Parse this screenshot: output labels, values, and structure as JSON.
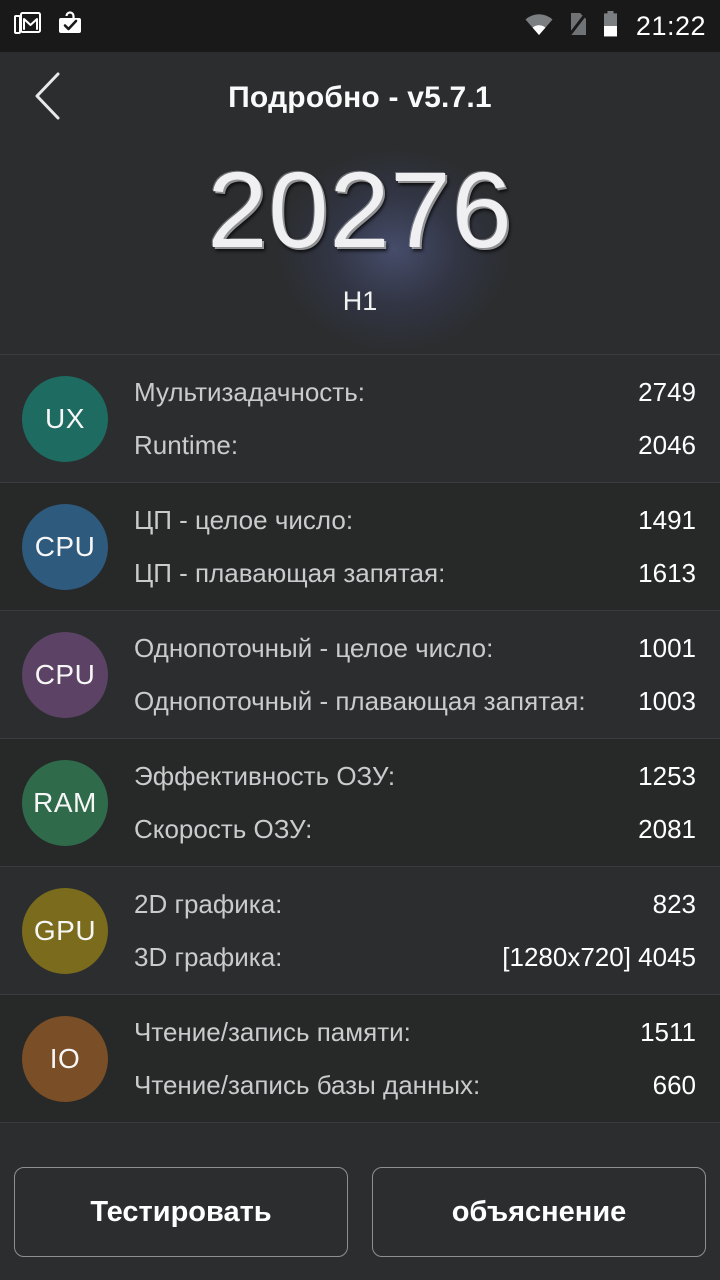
{
  "statusbar": {
    "icons_left": [
      "gmail-icon",
      "work-badge-icon"
    ],
    "icons_right": [
      "wifi-icon",
      "no-sim-icon",
      "battery-icon"
    ],
    "clock": "21:22"
  },
  "actionbar": {
    "back_icon": "back-chevron-icon",
    "title": "Подробно - v5.7.1"
  },
  "hero": {
    "score": "20276",
    "device": "H1"
  },
  "metrics": [
    {
      "badge": "UX",
      "badge_color": "#1e6b62",
      "lines": [
        {
          "label": "Мультизадачность:",
          "value": "2749"
        },
        {
          "label": "Runtime:",
          "value": "2046"
        }
      ]
    },
    {
      "badge": "CPU",
      "badge_color": "#2e5a7d",
      "lines": [
        {
          "label": "ЦП - целое число:",
          "value": "1491"
        },
        {
          "label": "ЦП - плавающая запятая:",
          "value": "1613"
        }
      ]
    },
    {
      "badge": "CPU",
      "badge_color": "#5c4264",
      "lines": [
        {
          "label": "Однопоточный - целое число:",
          "value": "1001"
        },
        {
          "label": "Однопоточный - плавающая запятая:",
          "value": "1003"
        }
      ]
    },
    {
      "badge": "RAM",
      "badge_color": "#2f6b4b",
      "lines": [
        {
          "label": "Эффективность ОЗУ:",
          "value": "1253"
        },
        {
          "label": "Скорость ОЗУ:",
          "value": "2081"
        }
      ]
    },
    {
      "badge": "GPU",
      "badge_color": "#7a6c1c",
      "lines": [
        {
          "label": "2D графика:",
          "value": "823"
        },
        {
          "label": "3D графика:",
          "value": "[1280x720] 4045"
        }
      ]
    },
    {
      "badge": "IO",
      "badge_color": "#7a4e26",
      "lines": [
        {
          "label": "Чтение/запись памяти:",
          "value": "1511"
        },
        {
          "label": "Чтение/запись базы данных:",
          "value": "660"
        }
      ]
    }
  ],
  "footer": {
    "test_label": "Тестировать",
    "explain_label": "объяснение"
  }
}
